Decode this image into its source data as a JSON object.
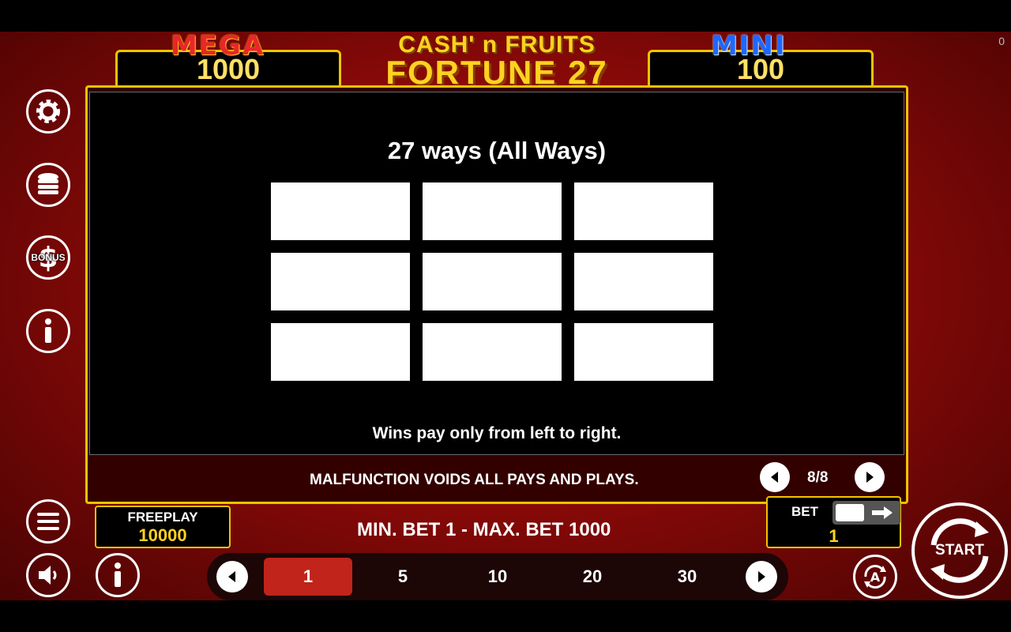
{
  "corner_counter": "0",
  "jackpots": {
    "mega": {
      "label": "MEGA",
      "value": "1000"
    },
    "mini": {
      "label": "MINI",
      "value": "100"
    }
  },
  "logo": {
    "line1": "CASH' n FRUITS",
    "line2": "FORTUNE 27"
  },
  "info_panel": {
    "title": "27 ways (All Ways)",
    "grid_rows": 3,
    "grid_cols": 3,
    "footer": "Wins pay only from left to right."
  },
  "notice": "MALFUNCTION VOIDS ALL PAYS AND PLAYS.",
  "pagination": {
    "indicator": "8/8"
  },
  "side_icons": [
    "gear-icon",
    "coins-icon",
    "bonus-dollar-icon",
    "info-icon"
  ],
  "bonus_icon_text": "BONUS",
  "freeplay": {
    "label": "FREEPLAY",
    "value": "10000"
  },
  "bet_range": "MIN. BET 1 - MAX. BET 1000",
  "bet": {
    "label": "BET",
    "value": "1"
  },
  "start_label": "START",
  "bet_options": [
    "1",
    "5",
    "10",
    "20",
    "30"
  ],
  "selected_bet_index": 0,
  "colors": {
    "gold": "#f2c200",
    "mega_red": "#e8262b",
    "mini_blue": "#1e68ff",
    "selected_bet": "#c0241a"
  }
}
